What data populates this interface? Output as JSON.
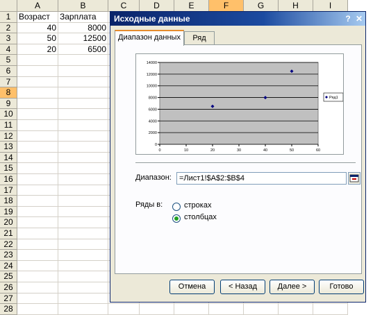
{
  "sheet": {
    "columns": [
      "A",
      "B",
      "C",
      "D",
      "E",
      "F",
      "G",
      "H",
      "I"
    ],
    "rows": [
      "1",
      "2",
      "3",
      "4",
      "5",
      "6",
      "7",
      "8",
      "9",
      "10",
      "11",
      "12",
      "13",
      "14",
      "15",
      "16",
      "17",
      "18",
      "19",
      "20",
      "21",
      "22",
      "23",
      "24",
      "25",
      "26",
      "27",
      "28"
    ],
    "cells": {
      "A1": "Возраст",
      "B1": "Зарплата",
      "A2": "40",
      "B2": "8000",
      "A3": "50",
      "B3": "12500",
      "A4": "20",
      "B4": "6500"
    },
    "selected_column": "F",
    "selected_row": "8"
  },
  "dialog": {
    "title": "Исходные данные",
    "help_button": "?",
    "close_button": "✕",
    "tabs": [
      {
        "label": "Диапазон данных",
        "active": true
      },
      {
        "label": "Ряд",
        "active": false
      }
    ],
    "range_label": "Диапазон:",
    "range_value": "=Лист1!$A$2:$B$4",
    "series_in_label": "Ряды в:",
    "radio_rows": "строках",
    "radio_columns": "столбцах",
    "selected_radio": "columns",
    "buttons": {
      "cancel": "Отмена",
      "back": "< Назад",
      "next": "Далее >",
      "finish": "Готово"
    }
  },
  "chart_data": {
    "type": "scatter",
    "series": [
      {
        "name": "Ряд1",
        "x": [
          40,
          50,
          20
        ],
        "y": [
          8000,
          12500,
          6500
        ]
      }
    ],
    "xlim": [
      0,
      60
    ],
    "ylim": [
      0,
      14000
    ],
    "x_ticks": [
      "0",
      "10",
      "20",
      "30",
      "40",
      "50",
      "60"
    ],
    "y_ticks": [
      "0",
      "2000",
      "4000",
      "6000",
      "8000",
      "10000",
      "12000",
      "14000"
    ],
    "grid": true,
    "plot_background": "#c0c0c0",
    "marker_color": "#000080",
    "legend_position": "right"
  }
}
